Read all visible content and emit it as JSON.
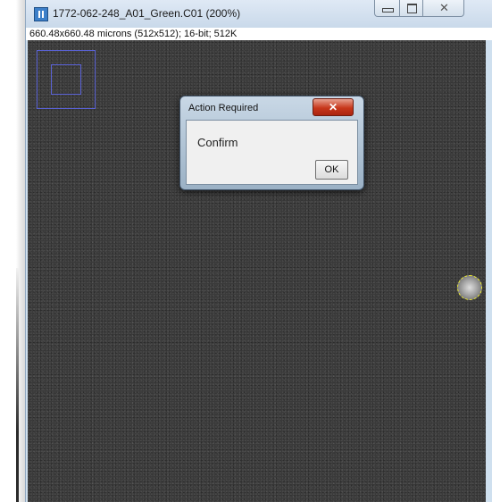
{
  "window": {
    "title": "1772-062-248_A01_Green.C01 (200%)",
    "info": "660.48x660.48 microns (512x512); 16-bit; 512K",
    "controls": {
      "minimize_icon": "minimize-icon",
      "maximize_icon": "maximize-icon",
      "close_icon": "close-icon",
      "close_glyph": "✕"
    }
  },
  "dialog": {
    "title": "Action Required",
    "close_glyph": "✕",
    "message": "Confirm",
    "ok_label": "OK"
  },
  "colors": {
    "navigator_border": "#5a62d6",
    "roi_outline": "#f1ef30",
    "dialog_close": "#c7371b",
    "image_background": "#3a3a3a"
  }
}
